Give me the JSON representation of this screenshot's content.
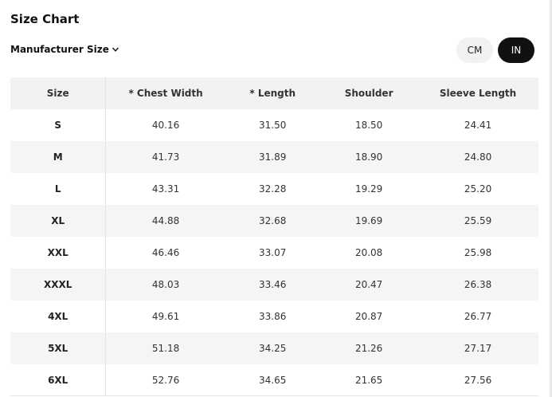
{
  "title": "Size Chart",
  "manufacturer_size_label": "Manufacturer Size",
  "units": {
    "cm": "CM",
    "in": "IN",
    "selected": "IN"
  },
  "table": {
    "headers": [
      "Size",
      "* Chest Width",
      "* Length",
      "Shoulder",
      "Sleeve Length"
    ],
    "rows": [
      [
        "S",
        "40.16",
        "31.50",
        "18.50",
        "24.41"
      ],
      [
        "M",
        "41.73",
        "31.89",
        "18.90",
        "24.80"
      ],
      [
        "L",
        "43.31",
        "32.28",
        "19.29",
        "25.20"
      ],
      [
        "XL",
        "44.88",
        "32.68",
        "19.69",
        "25.59"
      ],
      [
        "XXL",
        "46.46",
        "33.07",
        "20.08",
        "25.98"
      ],
      [
        "XXXL",
        "48.03",
        "33.46",
        "20.47",
        "26.38"
      ],
      [
        "4XL",
        "49.61",
        "33.86",
        "20.87",
        "26.77"
      ],
      [
        "5XL",
        "51.18",
        "34.25",
        "21.26",
        "27.17"
      ],
      [
        "6XL",
        "52.76",
        "34.65",
        "21.65",
        "27.56"
      ]
    ]
  },
  "colors": {
    "accent": "#111111",
    "header_bg": "#f2f2f2",
    "alt_row_bg": "#f5f5f5"
  }
}
